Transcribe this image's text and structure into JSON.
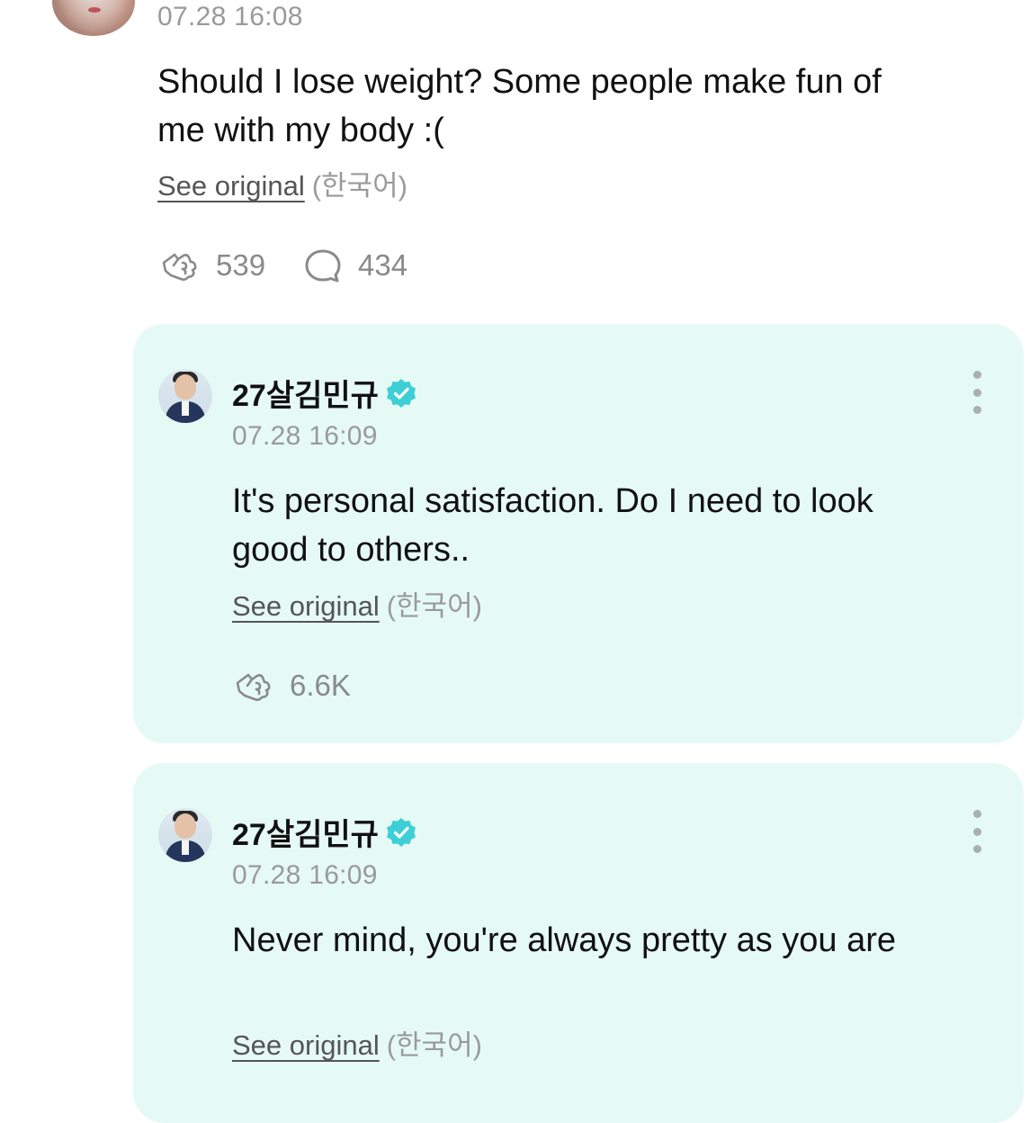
{
  "post": {
    "timestamp": "07.28 16:08",
    "body_line1": "Should I lose weight? Some people make fun of",
    "body_line2": "me with my body :(",
    "see_original": "See original",
    "language": "(한국어)",
    "like_count": "539",
    "comment_count": "434",
    "avatar_icon": "user-avatar-photo"
  },
  "replies": [
    {
      "username": "27살김민규",
      "verified_icon": "verified-badge-icon",
      "timestamp": "07.28 16:09",
      "body_line1": "It's personal satisfaction. Do I need to look",
      "body_line2": "good to others..",
      "see_original": "See original",
      "language": "(한국어)",
      "like_count": "6.6K"
    },
    {
      "username": "27살김민규",
      "verified_icon": "verified-badge-icon",
      "timestamp": "07.28 16:09",
      "body_line1": "Never mind, you're always pretty as you are",
      "see_original": "See original",
      "language": "(한국어)"
    }
  ],
  "colors": {
    "reply_background": "#e6faf5",
    "verified": "#3ecfd6",
    "muted_text": "#9a9a9a",
    "icon_gray": "#8a8a8a"
  },
  "icons": [
    "like-icon",
    "comment-icon",
    "more-options-icon",
    "verified-badge-icon"
  ]
}
